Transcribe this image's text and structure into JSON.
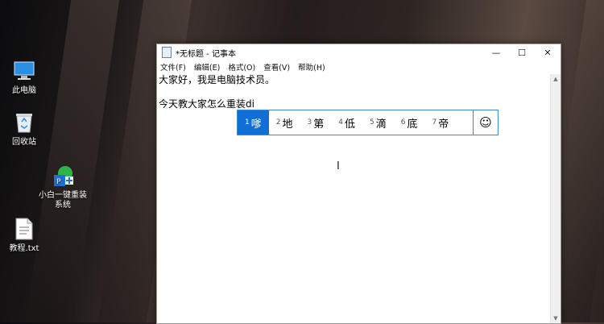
{
  "desktop": {
    "icons": [
      {
        "label": "此电脑"
      },
      {
        "label": "回收站"
      },
      {
        "label": "小白一键重装系统"
      },
      {
        "label": "教程.txt"
      }
    ]
  },
  "window": {
    "title": "*无标题 - 记事本",
    "controls": {
      "minimize": "—",
      "maximize": "☐",
      "close": "✕"
    },
    "menu": [
      "文件(F)",
      "编辑(E)",
      "格式(O)",
      "查看(V)",
      "帮助(H)"
    ],
    "content": {
      "line1": "大家好，我是电脑技术员。",
      "line2": "",
      "line3": "今天教大家怎么重装di"
    }
  },
  "ime": {
    "candidates": [
      {
        "num": "1",
        "text": "嗲"
      },
      {
        "num": "2",
        "text": "地"
      },
      {
        "num": "3",
        "text": "第"
      },
      {
        "num": "4",
        "text": "低"
      },
      {
        "num": "5",
        "text": "滴"
      },
      {
        "num": "6",
        "text": "底"
      },
      {
        "num": "7",
        "text": "帝"
      }
    ],
    "emoji_symbol": "☺",
    "accent_color": "#0f6fd6"
  }
}
